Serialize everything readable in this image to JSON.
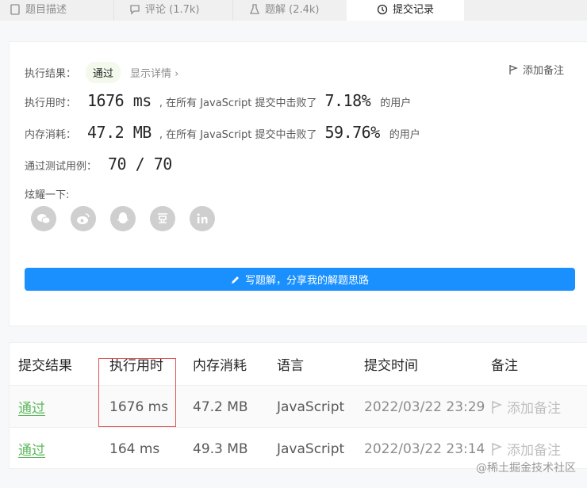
{
  "tabs": [
    {
      "label": "题目描述"
    },
    {
      "label": "评论 (1.7k)"
    },
    {
      "label": "题解 (2.4k)"
    },
    {
      "label": "提交记录"
    }
  ],
  "result": {
    "status_label": "执行结果：",
    "status_badge": "通过",
    "details_link": "显示详情 ›",
    "add_note": "添加备注",
    "runtime_label": "执行用时：",
    "runtime_value": "1676 ms",
    "runtime_text": ", 在所有 JavaScript 提交中击败了",
    "runtime_pct": "7.18%",
    "runtime_suffix": "的用户",
    "memory_label": "内存消耗：",
    "memory_value": "47.2 MB",
    "memory_text": ", 在所有 JavaScript 提交中击败了",
    "memory_pct": "59.76%",
    "memory_suffix": "的用户",
    "tests_label": "通过测试用例：",
    "tests_value": "70 / 70",
    "share_label": "炫耀一下:",
    "share_icons": [
      "wechat-icon",
      "weibo-icon",
      "qq-icon",
      "douban-icon",
      "linkedin-icon"
    ],
    "write_button": "写题解，分享我的解题思路"
  },
  "table": {
    "headers": [
      "提交结果",
      "执行用时",
      "内存消耗",
      "语言",
      "提交时间",
      "备注"
    ],
    "rows": [
      {
        "status": "通过",
        "runtime": "1676 ms",
        "memory": "47.2 MB",
        "language": "JavaScript",
        "time": "2022/03/22 23:29",
        "note": "添加备注"
      },
      {
        "status": "通过",
        "runtime": "164 ms",
        "memory": "49.3 MB",
        "language": "JavaScript",
        "time": "2022/03/22 23:14",
        "note": "添加备注"
      }
    ]
  },
  "watermark": "@稀土掘金技术社区",
  "colors": {
    "accent": "#1a90ff",
    "pass": "#5cb85c",
    "highlight": "#e05555"
  }
}
